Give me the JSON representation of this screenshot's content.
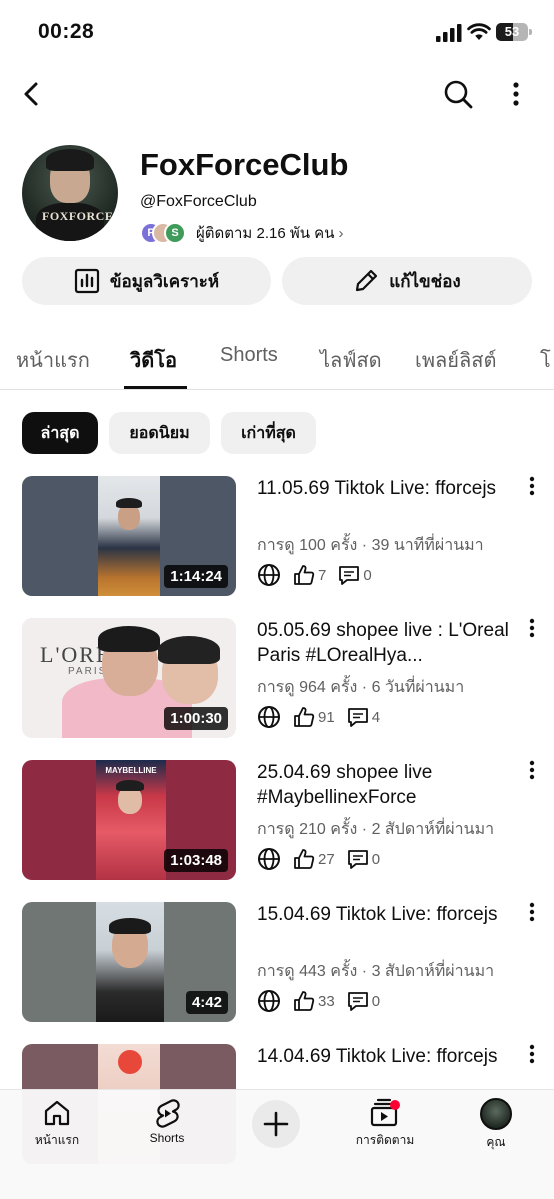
{
  "status_bar": {
    "time": "00:28",
    "battery": "53"
  },
  "channel": {
    "name": "FoxForceClub",
    "handle": "@FoxForceClub",
    "subscribers": "ผู้ติดตาม 2.16 พัน คน",
    "mini_avatar_initials": [
      "P",
      "S"
    ],
    "avatar_logo": "FOXFORCE"
  },
  "actions": {
    "analytics_label": "ข้อมูลวิเคราะห์",
    "edit_label": "แก้ไขช่อง"
  },
  "tabs": [
    "หน้าแรก",
    "วิดีโอ",
    "Shorts",
    "ไลฟ์สด",
    "เพลย์ลิสต์",
    "โ"
  ],
  "active_tab": "วิดีโอ",
  "chips": [
    "ล่าสุด",
    "ยอดนิยม",
    "เก่าที่สุด"
  ],
  "active_chip": "ล่าสุด",
  "videos": [
    {
      "title": "11.05.69 Tiktok Live: fforcejs",
      "meta": "การดู 100 ครั้ง · 39 นาทีที่ผ่านมา",
      "duration": "1:14:24",
      "likes": "7",
      "comments": "0"
    },
    {
      "title": "05.05.69 shopee live : L'Oreal Paris #LOrealHya...",
      "meta": "การดู 964 ครั้ง · 6 วันที่ผ่านมา",
      "duration": "1:00:30",
      "likes": "91",
      "comments": "4",
      "thumb_text": "L'OREAL",
      "thumb_sub": "PARIS"
    },
    {
      "title": "25.04.69 shopee live #MaybellinexForce",
      "meta": "การดู 210 ครั้ง · 2 สัปดาห์ที่ผ่านมา",
      "duration": "1:03:48",
      "likes": "27",
      "comments": "0",
      "thumb_text": "MAYBELLINE"
    },
    {
      "title": "15.04.69 Tiktok Live: fforcejs",
      "meta": "การดู 443 ครั้ง · 3 สัปดาห์ที่ผ่านมา",
      "duration": "4:42",
      "likes": "33",
      "comments": "0"
    },
    {
      "title": "14.04.69 Tiktok Live: fforcejs",
      "meta": "",
      "duration": "",
      "likes": "",
      "comments": ""
    }
  ],
  "bottom_nav": {
    "home": "หน้าแรก",
    "shorts": "Shorts",
    "subscriptions": "การติดตาม",
    "you": "คุณ"
  },
  "colors": {
    "text": "#0f0f0f",
    "secondary": "#606060",
    "chip_bg": "#f0f0f0",
    "notification": "#ff0033"
  },
  "icons": [
    "back-icon",
    "search-icon",
    "more-vert-icon",
    "analytics-icon",
    "pencil-icon",
    "globe-icon",
    "thumb-up-icon",
    "comment-icon",
    "home-icon",
    "shorts-icon",
    "plus-icon",
    "subscriptions-icon"
  ]
}
